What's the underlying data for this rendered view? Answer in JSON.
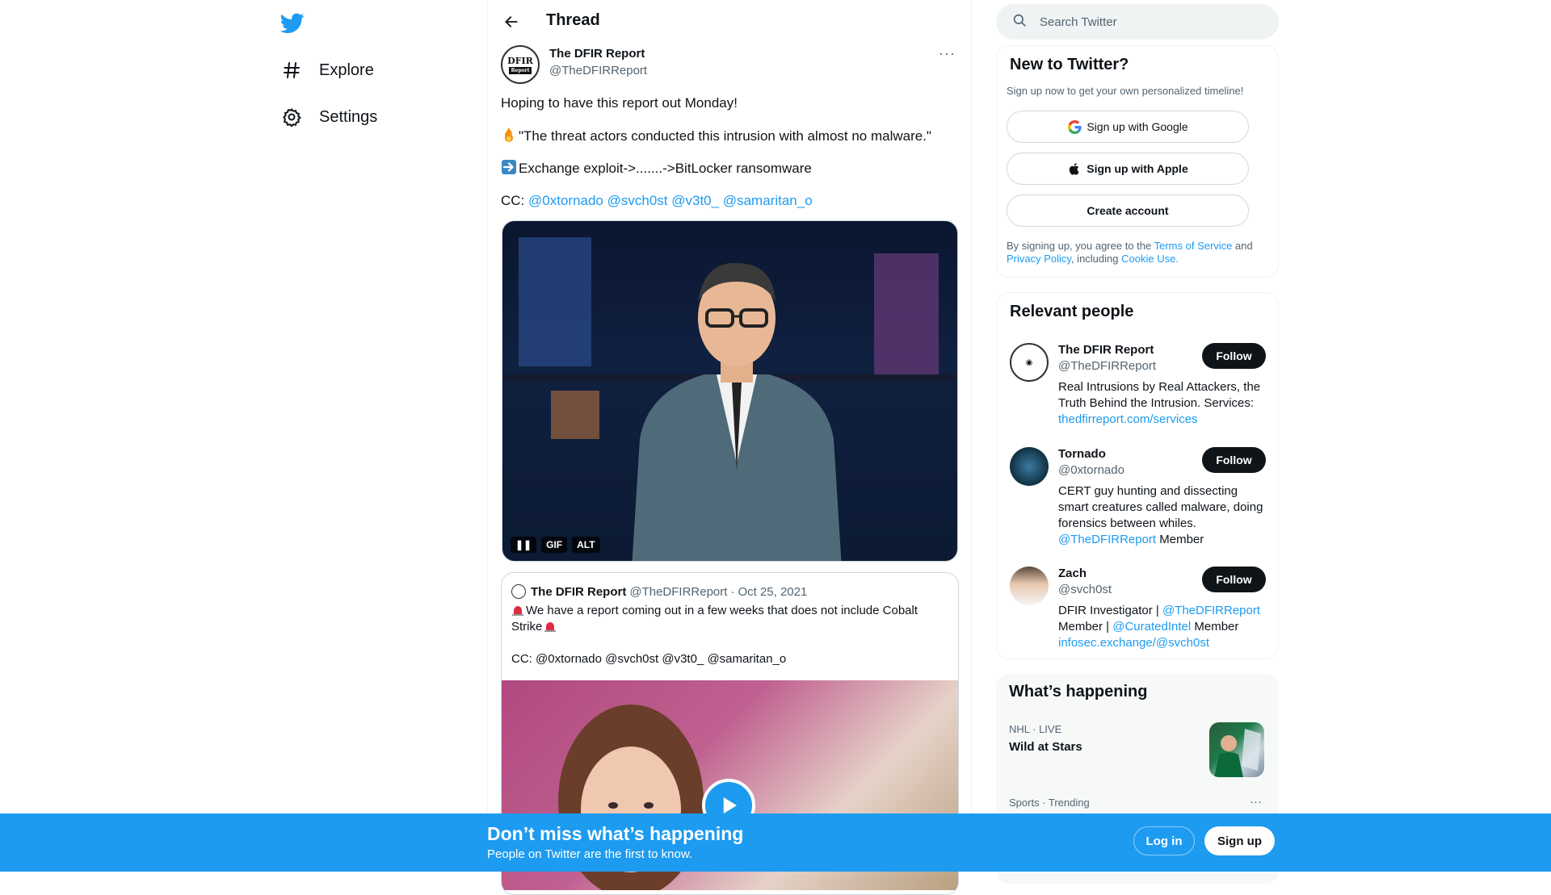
{
  "nav": {
    "items": [
      {
        "label": "Explore",
        "icon": "hashtag-icon"
      },
      {
        "label": "Settings",
        "icon": "gear-icon"
      }
    ]
  },
  "thread": {
    "title": "Thread",
    "author": {
      "name": "The DFIR Report",
      "handle": "@TheDFIRReport",
      "avatar_text": "DFIR",
      "avatar_tag": "Report"
    },
    "more_label": "···",
    "line1": "Hoping to have this report out Monday!",
    "line2": "\"The threat actors conducted this intrusion with almost no malware.\"",
    "line3": "Exchange exploit->.......->BitLocker ransomware",
    "cc_label": "CC:",
    "mentions": [
      "@0xtornado",
      "@svch0st",
      "@v3t0_",
      "@samaritan_o"
    ],
    "gif_controls": {
      "pause": "❚❚",
      "gif": "GIF",
      "alt": "ALT"
    },
    "quote": {
      "name": "The DFIR Report",
      "handle": "@TheDFIRReport",
      "sep": "·",
      "date": "Oct 25, 2021",
      "text1": "We have a report coming out in a few weeks that does not include Cobalt Strike",
      "text2": "CC: @0xtornado @svch0st @v3t0_ @samaritan_o"
    }
  },
  "search": {
    "placeholder": "Search Twitter"
  },
  "signup_card": {
    "title": "New to Twitter?",
    "subtitle": "Sign up now to get your own personalized timeline!",
    "google": "Sign up with Google",
    "apple": "Sign up with Apple",
    "create": "Create account",
    "legal_1": "By signing up, you agree to the ",
    "terms": "Terms of Service",
    "legal_2": " and ",
    "privacy": "Privacy Policy",
    "legal_3": ", including ",
    "cookie": "Cookie Use."
  },
  "relevant": {
    "title": "Relevant people",
    "follow_label": "Follow",
    "people": [
      {
        "name": "The DFIR Report",
        "handle": "@TheDFIRReport",
        "bio": "Real Intrusions by Real Attackers, the Truth Behind the Intrusion. Services:",
        "link": "thedfirreport.com/services"
      },
      {
        "name": "Tornado",
        "handle": "@0xtornado",
        "bio": "CERT guy hunting and dissecting smart creatures called malware, doing forensics between whiles.",
        "link": "@TheDFIRReport",
        "bio_tail": " Member"
      },
      {
        "name": "Zach",
        "handle": "@svch0st",
        "bio": "DFIR Investigator | ",
        "link": "@TheDFIRReport",
        "bio_mid": "Member | ",
        "link2": "@CuratedIntel",
        "bio_tail": " Member",
        "link3": "infosec.exchange/@svch0st"
      }
    ]
  },
  "happening": {
    "title": "What’s happening",
    "trends": [
      {
        "meta": "NHL · LIVE",
        "title": "Wild at Stars"
      },
      {
        "meta": "Sports · Trending",
        "more": "···"
      }
    ]
  },
  "bottom_bar": {
    "title": "Don’t miss what’s happening",
    "subtitle": "People on Twitter are the first to know.",
    "login": "Log in",
    "signup": "Sign up"
  },
  "colors": {
    "accent": "#1d9bf0",
    "text": "#0f1419",
    "muted": "#536471",
    "border": "#eff3f4"
  }
}
